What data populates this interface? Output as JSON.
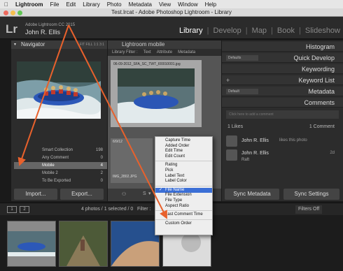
{
  "mac_menubar": {
    "apple": "",
    "items": [
      "Lightroom",
      "File",
      "Edit",
      "Library",
      "Photo",
      "Metadata",
      "View",
      "Window",
      "Help"
    ]
  },
  "window": {
    "title": "Test.lrcat - Adobe Photoshop Lightroom - Library"
  },
  "identity": {
    "logo": "Lr",
    "product": "Adobe Lightroom CC 2015",
    "user": "John R. Ellis"
  },
  "modules": [
    "Library",
    "Develop",
    "Map",
    "Book",
    "Slideshow"
  ],
  "left_panel": {
    "navigator_title": "Navigator",
    "navigator_opts": "FIT  FILL  1:1  3:1",
    "collections": [
      {
        "name": "Smart Collection",
        "count": "198"
      },
      {
        "name": "Any Comment",
        "count": "0"
      },
      {
        "name": "Mobile",
        "count": "4"
      },
      {
        "name": "Mobile 2",
        "count": "2"
      },
      {
        "name": "To Be Exported",
        "count": "0"
      }
    ],
    "import_label": "Import...",
    "export_label": "Export..."
  },
  "center": {
    "title": "Lightroom mobile",
    "filter_bar": [
      "Library Filter :",
      "Text",
      "Attribute",
      "Metadata"
    ],
    "cell1_name": "06-09-2012_SFA_SC_TWT_I00010001.jpg",
    "cell2_name": "6/9/12",
    "cell3_name": "IMG_2802.JPG",
    "sort_label": "S",
    "arrow_icon": "▾"
  },
  "sort_menu": {
    "items": [
      {
        "label": "Capture Time",
        "checked": false
      },
      {
        "label": "Added Order",
        "checked": false
      },
      {
        "label": "Edit Time",
        "checked": false
      },
      {
        "label": "Edit Count",
        "checked": false
      },
      {
        "divider": true
      },
      {
        "label": "Rating",
        "checked": false
      },
      {
        "label": "Pick",
        "checked": false
      },
      {
        "label": "Label Text",
        "checked": false
      },
      {
        "label": "Label Color",
        "checked": false
      },
      {
        "divider": true
      },
      {
        "label": "File Name",
        "checked": true
      },
      {
        "label": "File Extension",
        "checked": false
      },
      {
        "label": "File Type",
        "checked": false
      },
      {
        "label": "Aspect Ratio",
        "checked": false
      },
      {
        "divider": true
      },
      {
        "label": "Last Comment Time",
        "checked": false
      },
      {
        "divider": true
      },
      {
        "label": "Custom Order",
        "checked": false
      }
    ]
  },
  "right_panel": {
    "rows": [
      "Histogram",
      "Quick Develop",
      "Keywording",
      "Keyword List",
      "Metadata",
      "Comments"
    ],
    "quick_develop_preset": "Defaults",
    "metadata_preset": "Default",
    "comment_placeholder": "Click here to add a comment",
    "likes": "1 Likes",
    "comment_count": "1 Comment",
    "likes_this": "John R. Ellis",
    "likes_this_text": "likes this photo",
    "commenter": "John R. Ellis",
    "comment_age": "2d",
    "comment_text": "Raft",
    "sync_metadata": "Sync Metadata",
    "sync_settings": "Sync Settings"
  },
  "toolbar": {
    "pages": [
      "1",
      "2"
    ],
    "status": "4 photos / 1 selected / 0",
    "filter_label": "Filter :",
    "filters_off": "Filters Off"
  },
  "colors": {
    "accent": "#e8612c",
    "menu_highlight": "#3b6fd6"
  }
}
